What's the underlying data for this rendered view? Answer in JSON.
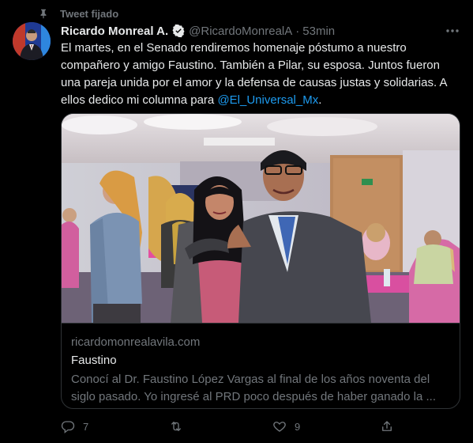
{
  "pinned_label": "Tweet fijado",
  "author": {
    "name": "Ricardo Monreal A.",
    "handle": "@RicardoMonrealA",
    "separator": "·",
    "time": "53min"
  },
  "tweet": {
    "lines": [
      "El martes, en el Senado rendiremos homenaje póstumo a nuestro",
      "compañero y amigo Faustino.  También a Pilar, su esposa. Juntos fueron",
      "una pareja unida por el amor y la defensa de causas justas y solidarias. A"
    ],
    "last_line_text": "ellos dedico mi columna para ",
    "mention": "@El_Universal_Mx",
    "last_line_end": "."
  },
  "card": {
    "domain": "ricardomonrealavila.com",
    "title": "Faustino",
    "description_lines": [
      "Conocí al Dr. Faustino López Vargas al final de los años noventa del",
      "siglo pasado. Yo ingresé al PRD poco después de haber ganado la ..."
    ]
  },
  "actions": {
    "reply_count": "7",
    "retweet_count": "",
    "like_count": "9"
  },
  "icons": {
    "pin": "pin-icon",
    "verified": "verified-badge-icon",
    "more": "more-options-icon",
    "reply": "reply-icon",
    "retweet": "retweet-icon",
    "like": "like-icon",
    "share": "share-icon"
  },
  "colors": {
    "background": "#000000",
    "text": "#e7e9ea",
    "secondary": "#71767b",
    "link": "#1d9bf0",
    "border": "#2f3336"
  }
}
